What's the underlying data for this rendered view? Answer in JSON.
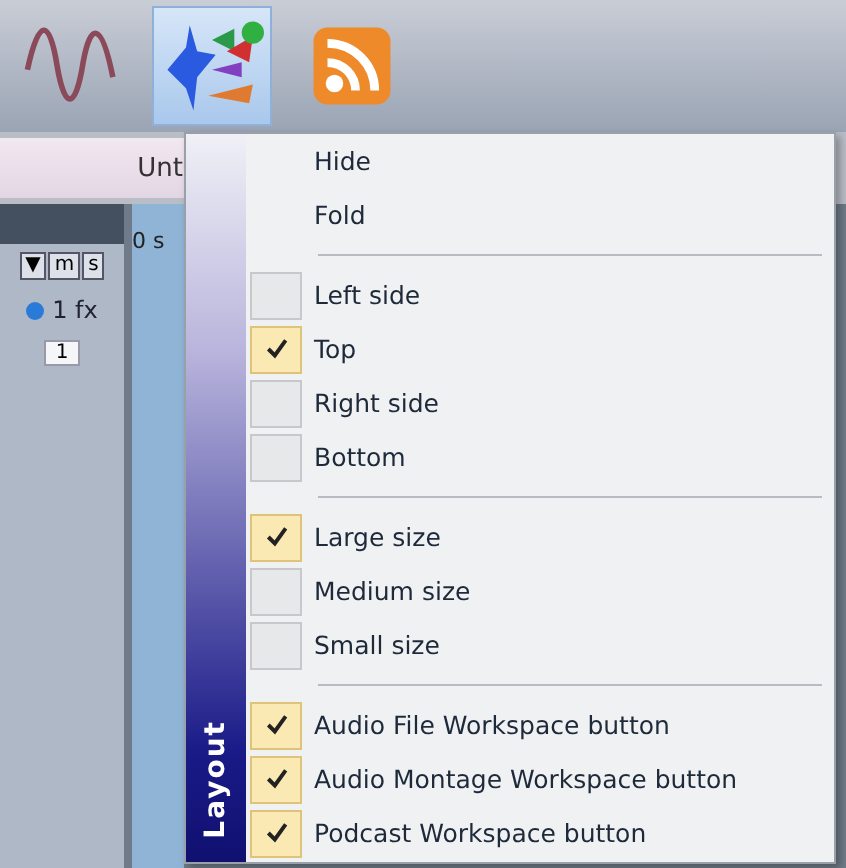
{
  "toolbar": {
    "buttons": [
      {
        "kind": "wave",
        "selected": false
      },
      {
        "kind": "workspace",
        "selected": true
      },
      {
        "kind": "rss",
        "selected": false
      }
    ]
  },
  "tab": {
    "label": "Unt"
  },
  "track": {
    "controls": [
      "▼",
      "m",
      "s"
    ],
    "fx": "1 fx",
    "number": "1",
    "ruler": "0 s"
  },
  "menu": {
    "title": "Layout",
    "sections": [
      [
        {
          "kind": "command",
          "label": "Hide"
        },
        {
          "kind": "command",
          "label": "Fold"
        }
      ],
      [
        {
          "kind": "check",
          "label": "Left side",
          "checked": false
        },
        {
          "kind": "check",
          "label": "Top",
          "checked": true
        },
        {
          "kind": "check",
          "label": "Right side",
          "checked": false
        },
        {
          "kind": "check",
          "label": "Bottom",
          "checked": false
        }
      ],
      [
        {
          "kind": "check",
          "label": "Large size",
          "checked": true
        },
        {
          "kind": "check",
          "label": "Medium size",
          "checked": false
        },
        {
          "kind": "check",
          "label": "Small size",
          "checked": false
        }
      ],
      [
        {
          "kind": "check",
          "label": "Audio File Workspace button",
          "checked": true
        },
        {
          "kind": "check",
          "label": "Audio Montage Workspace button",
          "checked": true
        },
        {
          "kind": "check",
          "label": "Podcast Workspace button",
          "checked": true
        }
      ]
    ]
  }
}
